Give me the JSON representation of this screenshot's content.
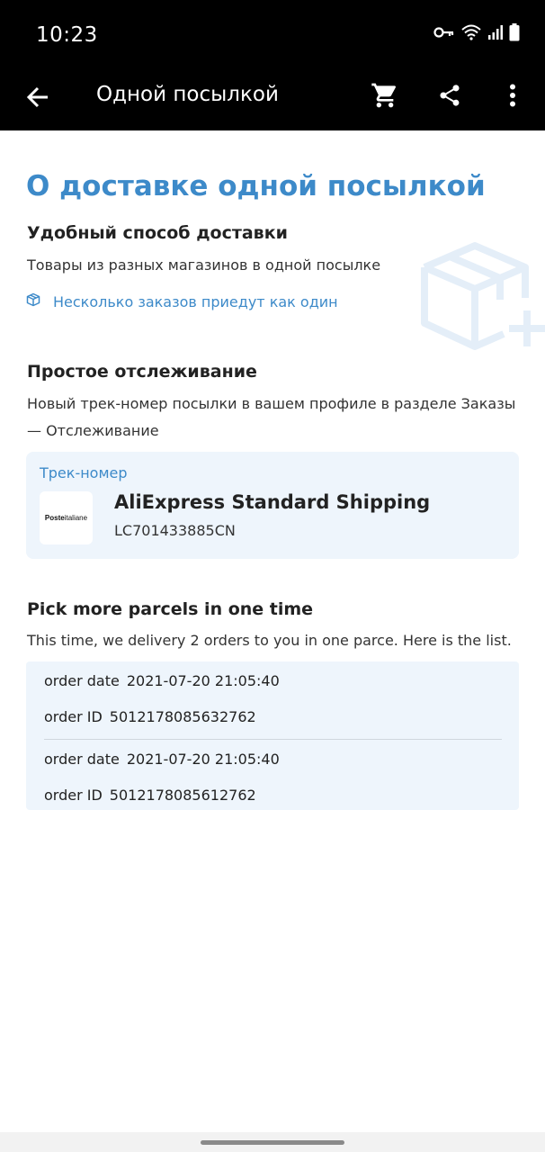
{
  "status_bar": {
    "time": "10:23",
    "icons": [
      "vpn-key-icon",
      "wifi-icon",
      "signal-icon",
      "battery-icon"
    ]
  },
  "app_bar": {
    "title": "Одной посылкой",
    "icons": [
      "back-arrow-icon",
      "cart-icon",
      "share-icon",
      "more-vert-icon"
    ]
  },
  "main": {
    "title": "О доставке одной посылкой",
    "sections": [
      {
        "title": "Удобный способ доставки",
        "text": "Товары из разных магазинов в одной посылке",
        "link": "Несколько заказов приедут как один"
      },
      {
        "title": "Простое отслеживание",
        "text_line1": "Новый трек-номер посылки в вашем профиле в разделе Заказы",
        "text_line2": "— Отслеживание"
      }
    ],
    "tracking": {
      "label": "Трек-номер",
      "logo_bold": "Poste",
      "logo_rest": "italiane",
      "carrier": "AliExpress Standard Shipping",
      "number": "LC701433885CN"
    },
    "orders": {
      "title": "Pick more parcels in one time",
      "description": "This time, we delivery 2 orders to you in one parce. Here is the list.",
      "items": [
        {
          "date_label": "order date",
          "date": "2021-07-20 21:05:40",
          "id_label": "order ID",
          "id": "5012178085632762"
        },
        {
          "date_label": "order date",
          "date": "2021-07-20 21:05:40",
          "id_label": "order ID",
          "id": "5012178085612762"
        }
      ]
    }
  },
  "colors": {
    "accent": "#3d8ac9",
    "card_bg": "#eef5fc",
    "bar_bg": "#000000"
  }
}
